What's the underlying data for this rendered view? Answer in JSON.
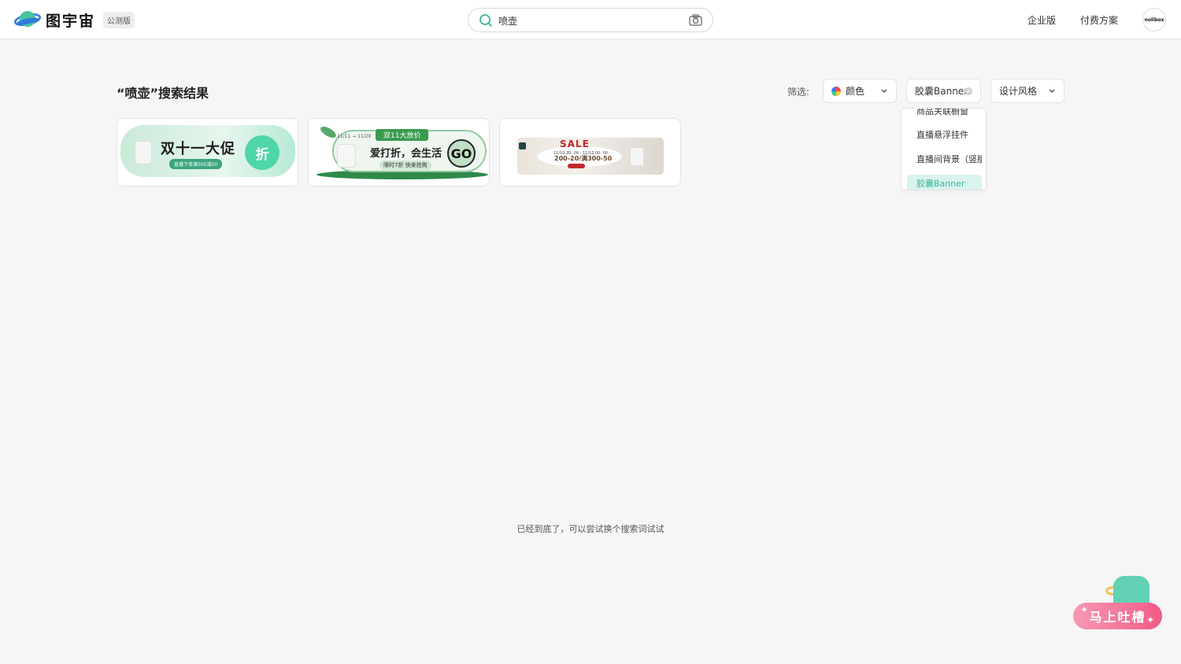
{
  "header": {
    "logo_text": "图宇宙",
    "beta_badge": "公测版",
    "search": {
      "value": "喷壶"
    },
    "nav": {
      "enterprise": "企业版",
      "pricing": "付费方案"
    },
    "avatar_text": "nolibox"
  },
  "results": {
    "title": "“喷壶”搜索结果",
    "filter_label": "筛选:",
    "filters": {
      "color": "颜色",
      "category": "胶囊Banner",
      "style": "设计风格"
    },
    "dropdown_items": [
      "商品关联橱窗",
      "直播悬浮挂件",
      "直播间背景（竖版",
      "胶囊Banner"
    ]
  },
  "cards": [
    {
      "title": "双十一大促",
      "subtitle": "直播下单满300减50",
      "badge": "折"
    },
    {
      "tag": "双11大放价",
      "date": "11/11 → 11/20",
      "title": "爱打折，会生活",
      "subtitle": "限时7折 快来抢购",
      "cta": "GO"
    },
    {
      "sale": "SALE",
      "dates": "11/10 20: 00 - 11/13 00: 00",
      "price": "200-20/满300-50"
    }
  ],
  "footer": {
    "end_text": "已经到底了，可以尝试换个搜索词试试",
    "feedback_button": "马上吐槽"
  },
  "colors": {
    "accent": "#3cb59c",
    "feedback": "#f15b86"
  }
}
